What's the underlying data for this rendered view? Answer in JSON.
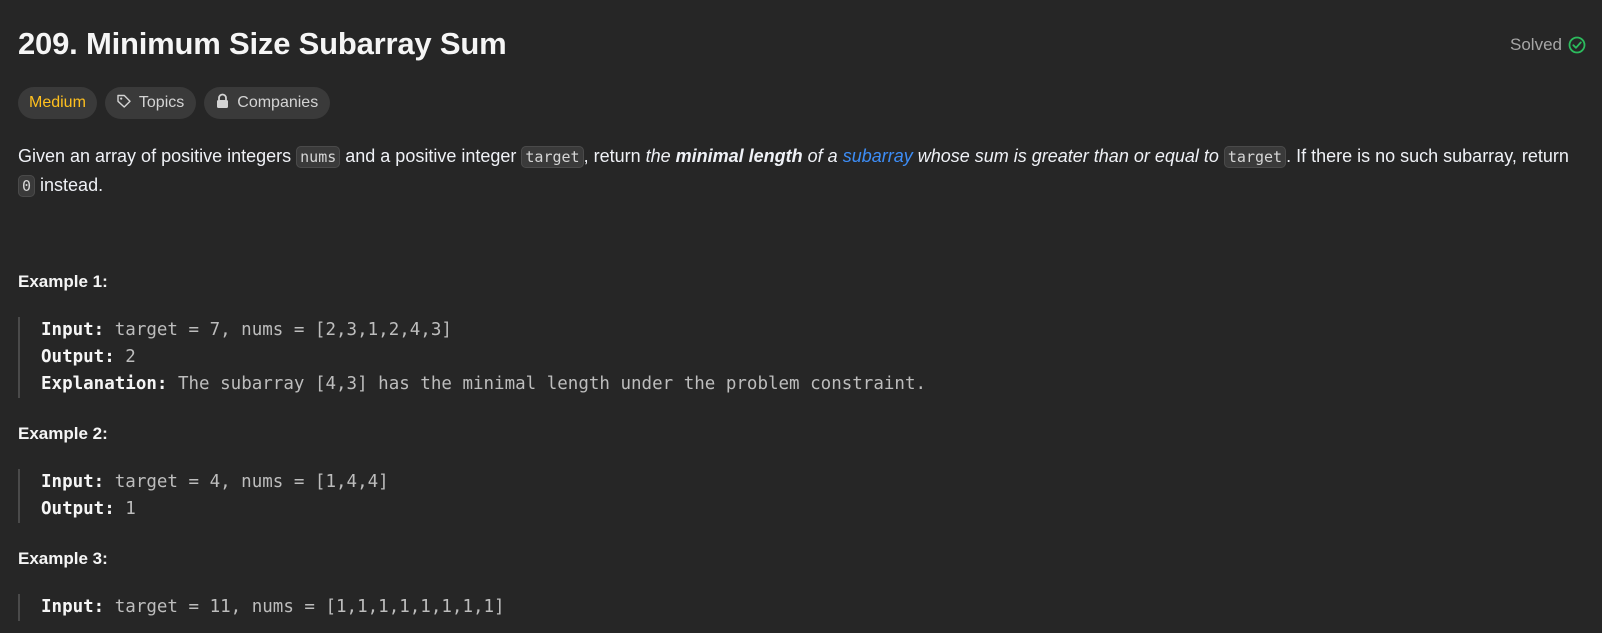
{
  "problem": {
    "title": "209. Minimum Size Subarray Sum",
    "status": "Solved",
    "difficulty": "Medium",
    "topics_label": "Topics",
    "companies_label": "Companies"
  },
  "description": {
    "p1": "Given an array of positive integers ",
    "code_nums": "nums",
    "p2": " and a positive integer ",
    "code_target": "target",
    "p3": ", return ",
    "em1": "the ",
    "strong": "minimal length",
    "em2": " of a ",
    "link": "subarray",
    "em3": " whose sum is greater than or equal to ",
    "code_target2": "target",
    "p4": ". If there is no such subarray, return ",
    "code_zero": "0",
    "p5": " instead."
  },
  "examples": [
    {
      "title": "Example 1:",
      "input_label": "Input:",
      "input": " target = 7, nums = [2,3,1,2,4,3]",
      "output_label": "Output:",
      "output": " 2",
      "explanation_label": "Explanation:",
      "explanation": " The subarray [4,3] has the minimal length under the problem constraint."
    },
    {
      "title": "Example 2:",
      "input_label": "Input:",
      "input": " target = 4, nums = [1,4,4]",
      "output_label": "Output:",
      "output": " 1"
    },
    {
      "title": "Example 3:",
      "input_label": "Input:",
      "input": " target = 11, nums = [1,1,1,1,1,1,1,1]"
    }
  ],
  "colors": {
    "background": "#262626",
    "difficulty_medium": "#ffc01e",
    "solved_check": "#2cbb5d",
    "link": "#3d8df6"
  }
}
